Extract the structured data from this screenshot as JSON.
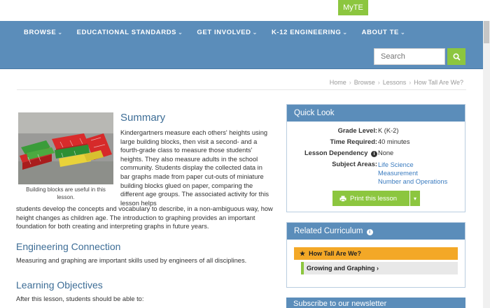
{
  "top": {
    "myte_label": "MyTE"
  },
  "nav": {
    "items": [
      {
        "label": "BROWSE"
      },
      {
        "label": "EDUCATIONAL STANDARDS"
      },
      {
        "label": "GET INVOLVED"
      },
      {
        "label": "K-12 ENGINEERING"
      },
      {
        "label": "ABOUT TE"
      }
    ],
    "search_placeholder": "Search"
  },
  "breadcrumb": [
    "Home",
    "Browse",
    "Lessons",
    "How Tall Are We?"
  ],
  "hero": {
    "caption": "Building blocks are useful in this lesson."
  },
  "summary": {
    "title": "Summary",
    "text_top": "Kindergartners measure each others' heights using large building blocks, then visit a second- and a fourth-grade class to measure those students' heights. They also measure adults in the school community. Students display the collected data in bar graphs made from paper cut-outs of miniature building blocks glued on paper, comparing the different age groups. The associated activity for this lesson helps",
    "text_bottom": "students develop the concepts and vocabulary to describe, in a non-ambiguous way, how height changes as children age. The introduction to graphing provides an important foundation for both creating and interpreting graphs in future years."
  },
  "engineering": {
    "title": "Engineering Connection",
    "text": "Measuring and graphing are important skills used by engineers of all disciplines."
  },
  "objectives": {
    "title": "Learning Objectives",
    "text": "After this lesson, students should be able to:"
  },
  "quick_look": {
    "title": "Quick Look",
    "grade_label": "Grade Level:",
    "grade_value": "K (K-2)",
    "time_label": "Time Required:",
    "time_value": "40 minutes",
    "dependency_label": "Lesson Dependency",
    "dependency_value": "None",
    "subjects_label": "Subject Areas:",
    "subjects": [
      "Life Science",
      "Measurement",
      "Number and Operations"
    ],
    "print_label": "Print this lesson"
  },
  "related": {
    "title": "Related Curriculum",
    "item1": "How Tall Are We?",
    "item2": "Growing and Graphing"
  },
  "newsletter": {
    "title": "Subscribe to our newsletter"
  },
  "colors": {
    "nav_blue": "#5b8dba",
    "accent_green": "#8cc63f",
    "highlight_orange": "#f3a827",
    "link_blue": "#3a7bbf"
  }
}
